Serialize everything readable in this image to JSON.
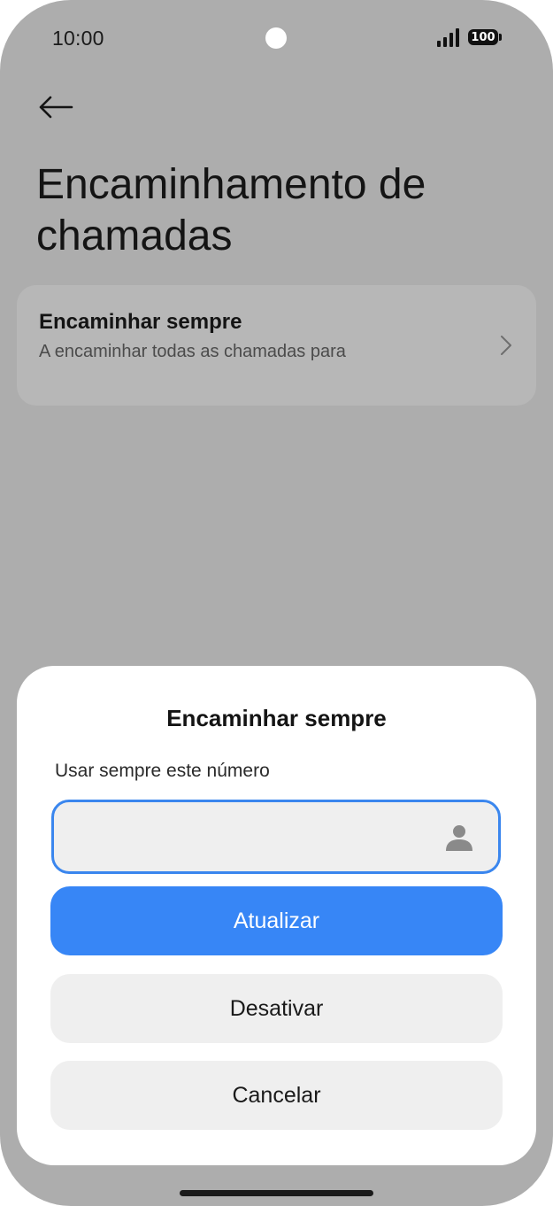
{
  "status_bar": {
    "time": "10:00",
    "battery": "100",
    "icons": [
      "camera-dot",
      "signal-icon",
      "battery-icon"
    ]
  },
  "header": {
    "back_icon": "arrow-left-icon",
    "title": "Encaminhamento de chamadas"
  },
  "settings_list": {
    "items": [
      {
        "title": "Encaminhar sempre",
        "subtitle": "A encaminhar todas as chamadas para",
        "icon": "chevron-right-icon"
      }
    ]
  },
  "dialog": {
    "title": "Encaminhar sempre",
    "label": "Usar sempre este número",
    "number_input": {
      "value": "",
      "placeholder": ""
    },
    "contact_icon": "contact-person-icon",
    "update_label": "Atualizar",
    "deactivate_label": "Desativar",
    "cancel_label": "Cancelar"
  },
  "colors": {
    "accent": "#3786f6",
    "scrim": "#adadad",
    "sheet_bg": "#ffffff",
    "secondary_button": "#efefef"
  }
}
